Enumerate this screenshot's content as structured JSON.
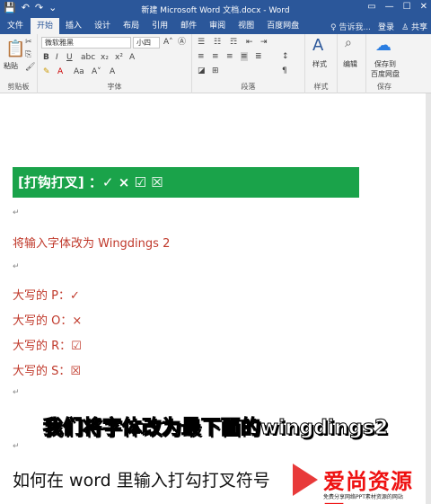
{
  "titlebar": {
    "title": "新建 Microsoft Word 文档.docx - Word",
    "qat": [
      "💾",
      "↶",
      "↷",
      "⌄"
    ],
    "winctl": [
      "▭",
      "—",
      "☐",
      "✕"
    ]
  },
  "tabs": [
    "文件",
    "开始",
    "插入",
    "设计",
    "布局",
    "引用",
    "邮件",
    "审阅",
    "视图",
    "百度网盘",
    "♀ 告诉我...",
    "登录",
    "♙ 共享"
  ],
  "ribbon": {
    "clipboard": {
      "paste": "粘贴",
      "label": "剪贴板"
    },
    "font": {
      "name": "微软雅黑",
      "size": "小四",
      "label": "字体"
    },
    "paragraph": {
      "label": "段落"
    },
    "styles": {
      "btn": "样式",
      "label": "样式"
    },
    "editing": {
      "btn": "编辑"
    },
    "save": {
      "btn": "保存到\n百度网盘",
      "label": "保存"
    }
  },
  "doc": {
    "banner": "[打钩打叉]  ：✓   ×   ☑   ☒",
    "line1": "将输入字体改为    Wingdings 2",
    "p": "大写的 P：✓",
    "o": "大写的 O：×",
    "r": "大写的 R：☑",
    "s": "大写的 S：☒",
    "para_mark": "↵"
  },
  "caption": "我们将字体改为最下面的wingdings2",
  "footer_title": "如何在 word 里输入打勾打叉符号",
  "logo": {
    "name": "爱尚资源网",
    "tagline": "免费分享网络PPT素材资源的网站"
  }
}
